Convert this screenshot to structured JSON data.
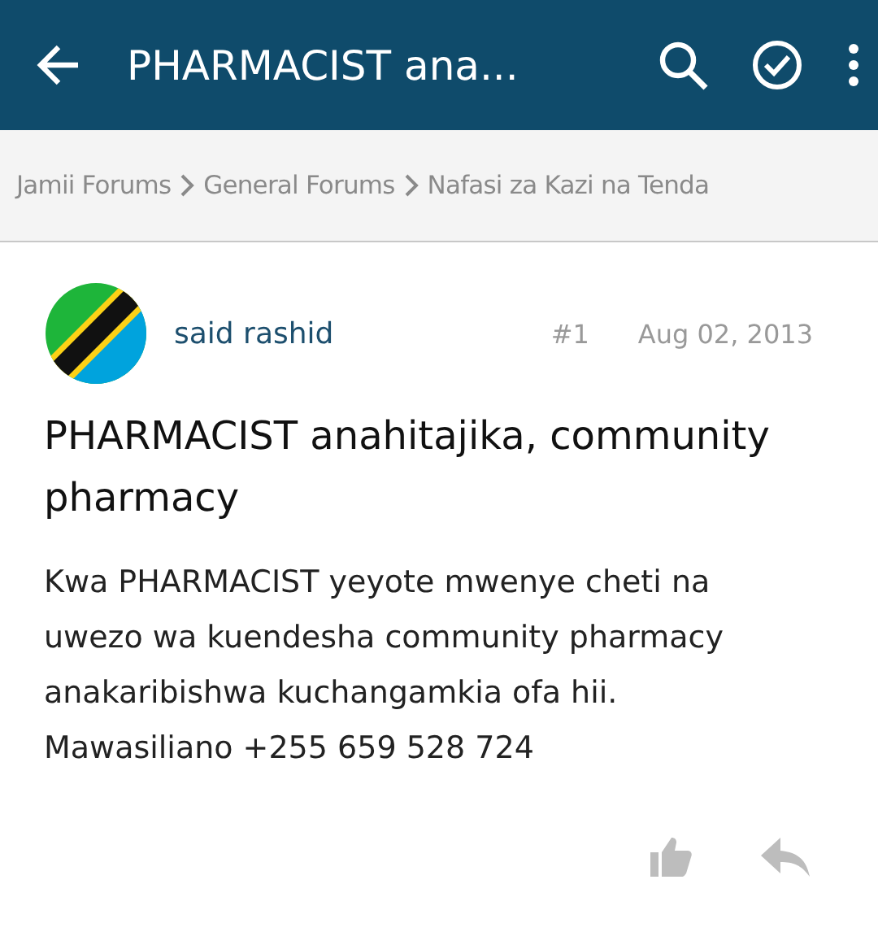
{
  "app_bar": {
    "title": "PHARMACIST ana..."
  },
  "breadcrumbs": [
    {
      "label": "Jamii Forums"
    },
    {
      "label": "General Forums"
    },
    {
      "label": "Nafasi za Kazi na Tenda"
    }
  ],
  "post": {
    "author": "said rashid",
    "number": "#1",
    "date": "Aug 02, 2013",
    "title": "PHARMACIST anahitajika, community pharmacy",
    "body": "Kwa PHARMACIST yeyote mwenye cheti na uwezo wa kuendesha community pharmacy anakaribishwa kuchangamkia ofa hii. Mawasiliano +255 659 528 724"
  }
}
